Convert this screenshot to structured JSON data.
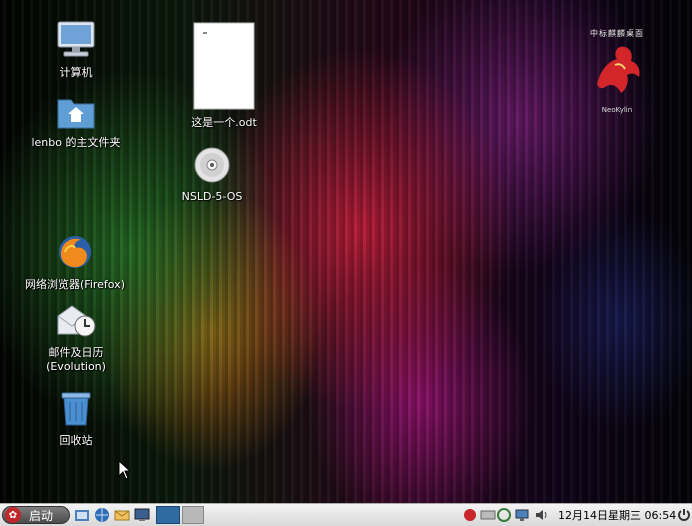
{
  "desktop": {
    "icons": [
      {
        "label": "计算机"
      },
      {
        "label": "lenbo 的主文件夹"
      },
      {
        "label": "网络浏览器(Firefox)"
      },
      {
        "label": "邮件及日历\n(Evolution)"
      },
      {
        "label": "回收站"
      },
      {
        "label": "这是一个.odt"
      },
      {
        "label": "NSLD-5-OS"
      }
    ],
    "brand": {
      "top": "中标麒麟桌面",
      "name": "NeoKylin"
    }
  },
  "taskbar": {
    "start_label": "启动",
    "clock": "12月14日星期三  06:54"
  }
}
